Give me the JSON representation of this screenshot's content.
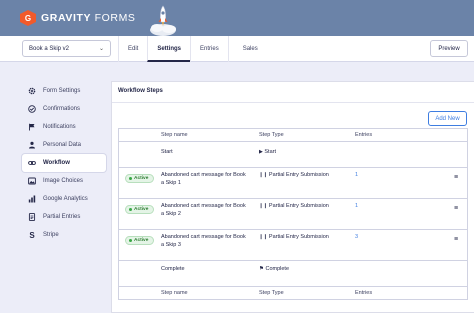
{
  "brand": {
    "name_bold": "GRAVITY",
    "name_light": " FORMS",
    "mark": "G"
  },
  "toolbar": {
    "form_name": "Book a Skip v2",
    "tabs": [
      {
        "label": "Edit",
        "active": false
      },
      {
        "label": "Settings",
        "active": true
      },
      {
        "label": "Entries",
        "active": false
      },
      {
        "label": "Sales",
        "active": false
      }
    ],
    "preview_label": "Preview"
  },
  "sidebar": {
    "items": [
      {
        "label": "Form Settings",
        "icon": "gear-icon"
      },
      {
        "label": "Confirmations",
        "icon": "check-circle-icon"
      },
      {
        "label": "Notifications",
        "icon": "flag-icon"
      },
      {
        "label": "Personal Data",
        "icon": "person-icon"
      },
      {
        "label": "Workflow",
        "icon": "link-icon",
        "active": true
      },
      {
        "label": "Image Choices",
        "icon": "image-icon"
      },
      {
        "label": "Google Analytics",
        "icon": "bar-chart-icon"
      },
      {
        "label": "Partial Entries",
        "icon": "document-icon"
      },
      {
        "label": "Stripe",
        "icon": "stripe-icon"
      }
    ]
  },
  "panel": {
    "title": "Workflow Steps",
    "add_label": "Add New",
    "columns": {
      "name": "Step name",
      "type": "Step Type",
      "entries": "Entries"
    },
    "start": {
      "name": "Start",
      "type": "Start",
      "icon": "play-icon"
    },
    "steps": [
      {
        "status": "Active",
        "name_line1": "Abandoned cart message for Book",
        "name_line2": "a Skip 1",
        "type": "Partial Entry Submission",
        "entries": "1"
      },
      {
        "status": "Active",
        "name_line1": "Abandoned cart message for Book",
        "name_line2": "a Skip 2",
        "type": "Partial Entry Submission",
        "entries": "1"
      },
      {
        "status": "Active",
        "name_line1": "Abandoned cart message for Book",
        "name_line2": "a Skip 3",
        "type": "Partial Entry Submission",
        "entries": "3"
      }
    ],
    "complete": {
      "name": "Complete",
      "type": "Complete",
      "icon": "flag-checkered-icon"
    }
  },
  "colors": {
    "header": "#6b83a8",
    "accent": "#3e7de1",
    "active_green": "#2e7d32",
    "logo": "#f15a2b"
  }
}
